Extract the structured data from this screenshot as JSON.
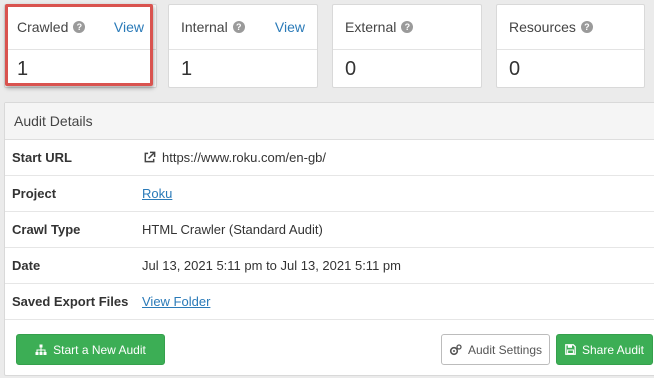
{
  "cards": [
    {
      "title": "Crawled",
      "link": "View",
      "value": "1"
    },
    {
      "title": "Internal",
      "link": "View",
      "value": "1"
    },
    {
      "title": "External",
      "value": "0"
    },
    {
      "title": "Resources",
      "value": "0"
    }
  ],
  "help_glyph": "?",
  "audit": {
    "header": "Audit Details",
    "rows": [
      {
        "label": "Start URL",
        "value": "https://www.roku.com/en-gb/"
      },
      {
        "label": "Project",
        "value": "Roku"
      },
      {
        "label": "Crawl Type",
        "value": "HTML Crawler (Standard Audit)"
      },
      {
        "label": "Date",
        "value": "Jul 13, 2021 5:11 pm to Jul 13, 2021 5:11 pm"
      },
      {
        "label": "Saved Export Files",
        "value": "View Folder"
      }
    ]
  },
  "buttons": {
    "new_audit": "Start a New Audit",
    "settings": "Audit Settings",
    "share": "Share Audit"
  },
  "colors": {
    "green": "#3cae55",
    "link": "#2a7ab8",
    "highlight": "#d9534f"
  }
}
